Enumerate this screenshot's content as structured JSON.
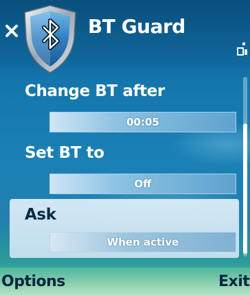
{
  "app": {
    "title": "BT Guard"
  },
  "settings": [
    {
      "label": "Change BT after",
      "value": "00:05"
    },
    {
      "label": "Set BT to",
      "value": "Off"
    },
    {
      "label": "Ask",
      "value": "When active"
    }
  ],
  "softkeys": {
    "left": "Options",
    "right": "Exit"
  },
  "icons": {
    "close": "close-icon",
    "logo": "bluetooth-shield-icon",
    "signal": "signal-icon"
  },
  "colors": {
    "background": "#1476ad",
    "highlight": "#e1f0fa",
    "text": "#ffffff"
  }
}
